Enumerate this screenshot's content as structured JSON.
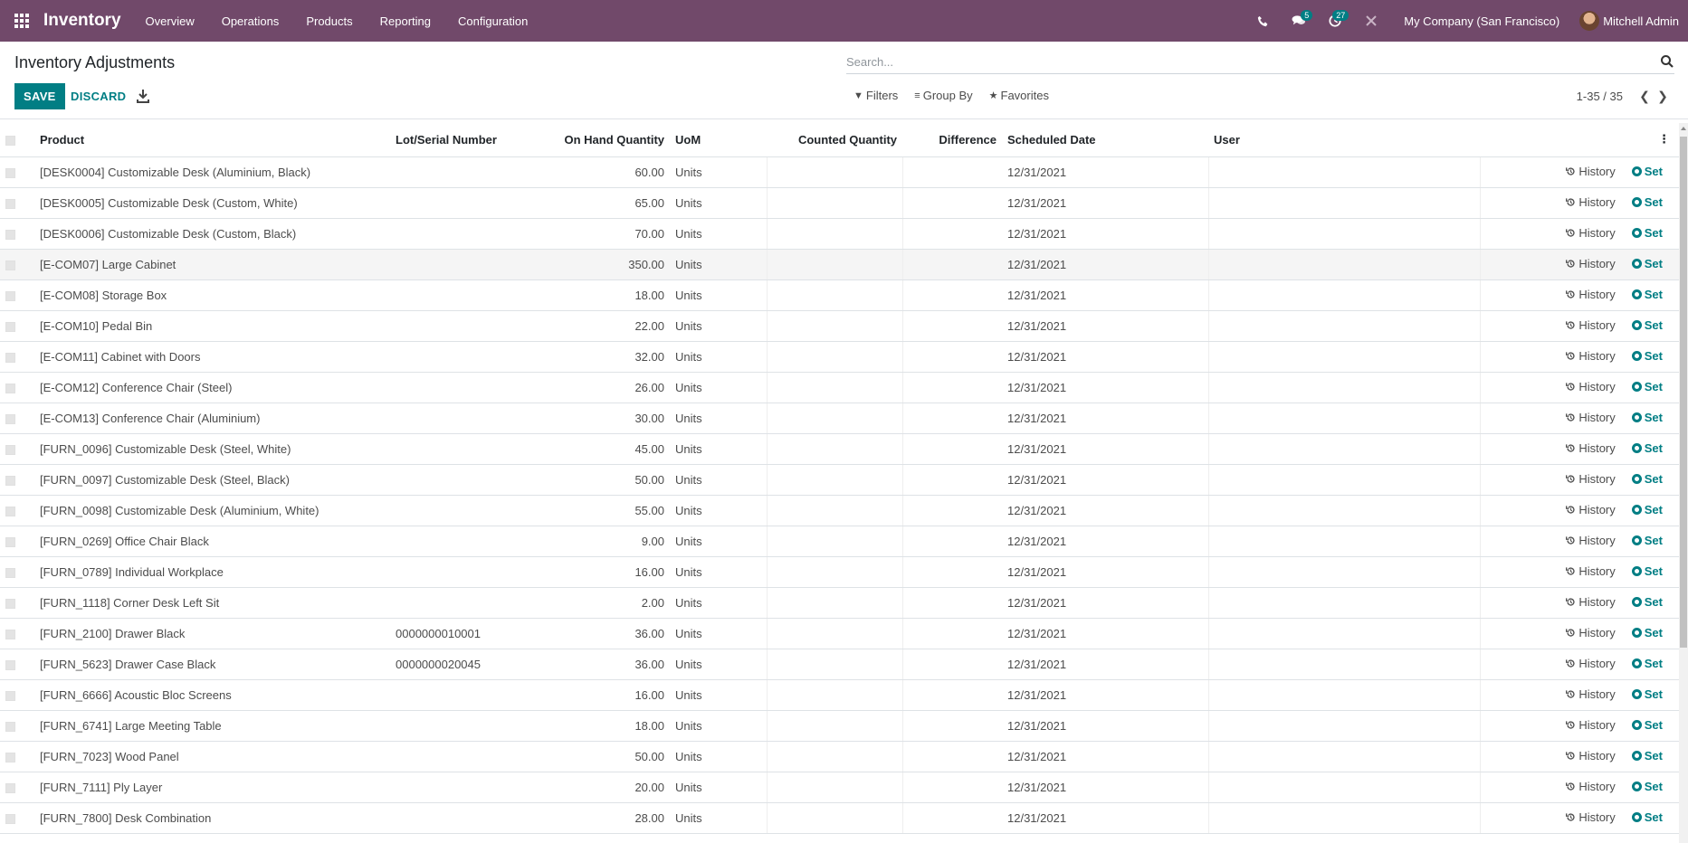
{
  "navbar": {
    "app_name": "Inventory",
    "menu": [
      "Overview",
      "Operations",
      "Products",
      "Reporting",
      "Configuration"
    ],
    "messages_badge": "5",
    "activities_badge": "27",
    "company": "My Company (San Francisco)",
    "user": "Mitchell Admin"
  },
  "control": {
    "breadcrumb": "Inventory Adjustments",
    "search_placeholder": "Search...",
    "save_label": "SAVE",
    "discard_label": "DISCARD",
    "filters_label": "Filters",
    "groupby_label": "Group By",
    "favorites_label": "Favorites",
    "pager_value": "1-35 / 35"
  },
  "table": {
    "headers": {
      "product": "Product",
      "lot": "Lot/Serial Number",
      "onhand": "On Hand Quantity",
      "uom": "UoM",
      "counted": "Counted Quantity",
      "difference": "Difference",
      "date": "Scheduled Date",
      "user": "User"
    },
    "history_label": "History",
    "set_label": "Set",
    "rows": [
      {
        "product": "[DESK0004] Customizable Desk (Aluminium, Black)",
        "lot": "",
        "onhand": "60.00",
        "uom": "Units",
        "date": "12/31/2021"
      },
      {
        "product": "[DESK0005] Customizable Desk (Custom, White)",
        "lot": "",
        "onhand": "65.00",
        "uom": "Units",
        "date": "12/31/2021"
      },
      {
        "product": "[DESK0006] Customizable Desk (Custom, Black)",
        "lot": "",
        "onhand": "70.00",
        "uom": "Units",
        "date": "12/31/2021"
      },
      {
        "product": "[E-COM07] Large Cabinet",
        "lot": "",
        "onhand": "350.00",
        "uom": "Units",
        "date": "12/31/2021"
      },
      {
        "product": "[E-COM08] Storage Box",
        "lot": "",
        "onhand": "18.00",
        "uom": "Units",
        "date": "12/31/2021"
      },
      {
        "product": "[E-COM10] Pedal Bin",
        "lot": "",
        "onhand": "22.00",
        "uom": "Units",
        "date": "12/31/2021"
      },
      {
        "product": "[E-COM11] Cabinet with Doors",
        "lot": "",
        "onhand": "32.00",
        "uom": "Units",
        "date": "12/31/2021"
      },
      {
        "product": "[E-COM12] Conference Chair (Steel)",
        "lot": "",
        "onhand": "26.00",
        "uom": "Units",
        "date": "12/31/2021"
      },
      {
        "product": "[E-COM13] Conference Chair (Aluminium)",
        "lot": "",
        "onhand": "30.00",
        "uom": "Units",
        "date": "12/31/2021"
      },
      {
        "product": "[FURN_0096] Customizable Desk (Steel, White)",
        "lot": "",
        "onhand": "45.00",
        "uom": "Units",
        "date": "12/31/2021"
      },
      {
        "product": "[FURN_0097] Customizable Desk (Steel, Black)",
        "lot": "",
        "onhand": "50.00",
        "uom": "Units",
        "date": "12/31/2021"
      },
      {
        "product": "[FURN_0098] Customizable Desk (Aluminium, White)",
        "lot": "",
        "onhand": "55.00",
        "uom": "Units",
        "date": "12/31/2021"
      },
      {
        "product": "[FURN_0269] Office Chair Black",
        "lot": "",
        "onhand": "9.00",
        "uom": "Units",
        "date": "12/31/2021"
      },
      {
        "product": "[FURN_0789] Individual Workplace",
        "lot": "",
        "onhand": "16.00",
        "uom": "Units",
        "date": "12/31/2021"
      },
      {
        "product": "[FURN_1118] Corner Desk Left Sit",
        "lot": "",
        "onhand": "2.00",
        "uom": "Units",
        "date": "12/31/2021"
      },
      {
        "product": "[FURN_2100] Drawer Black",
        "lot": "0000000010001",
        "onhand": "36.00",
        "uom": "Units",
        "date": "12/31/2021"
      },
      {
        "product": "[FURN_5623] Drawer Case Black",
        "lot": "0000000020045",
        "onhand": "36.00",
        "uom": "Units",
        "date": "12/31/2021"
      },
      {
        "product": "[FURN_6666] Acoustic Bloc Screens",
        "lot": "",
        "onhand": "16.00",
        "uom": "Units",
        "date": "12/31/2021"
      },
      {
        "product": "[FURN_6741] Large Meeting Table",
        "lot": "",
        "onhand": "18.00",
        "uom": "Units",
        "date": "12/31/2021"
      },
      {
        "product": "[FURN_7023] Wood Panel",
        "lot": "",
        "onhand": "50.00",
        "uom": "Units",
        "date": "12/31/2021"
      },
      {
        "product": "[FURN_7111] Ply Layer",
        "lot": "",
        "onhand": "20.00",
        "uom": "Units",
        "date": "12/31/2021"
      },
      {
        "product": "[FURN_7800] Desk Combination",
        "lot": "",
        "onhand": "28.00",
        "uom": "Units",
        "date": "12/31/2021"
      }
    ]
  },
  "colors": {
    "navbar": "#71496a",
    "accent": "#017e84"
  },
  "icons": [
    "apps-grid-icon",
    "phone-icon",
    "chat-icon",
    "clock-icon",
    "close-icon",
    "search-icon",
    "download-icon",
    "filter-icon",
    "groupby-icon",
    "star-icon",
    "chevron-left-icon",
    "chevron-right-icon",
    "history-icon",
    "set-icon",
    "kebab-icon"
  ]
}
